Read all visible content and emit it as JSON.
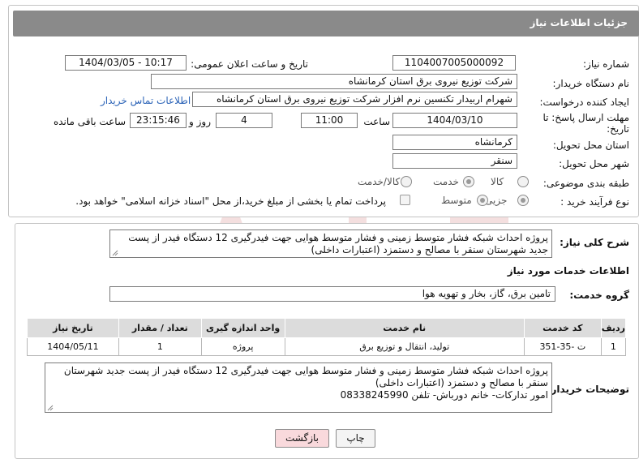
{
  "header": {
    "title": "جزئیات اطلاعات نیاز"
  },
  "form": {
    "need_number_label": "شماره نیاز:",
    "need_number": "1104007005000092",
    "announce_label": "تاریخ و ساعت اعلان عمومی:",
    "announce_value": "1404/03/05 - 10:17",
    "buyer_label": "نام دستگاه خریدار:",
    "buyer_value": "شرکت توزیع نیروی برق استان کرمانشاه",
    "creator_label": "ایجاد کننده درخواست:",
    "creator_value": "شهرام اربیدار تکنسین نرم افزار شرکت توزیع نیروی برق استان کرمانشاه",
    "contact_link": "اطلاعات تماس خریدار",
    "deadline_label_1": "مهلت ارسال پاسخ: تا",
    "deadline_label_2": "تاریخ:",
    "deadline_date": "1404/03/10",
    "time_label": "ساعت",
    "deadline_time": "11:00",
    "days_value": "4",
    "days_label": "روز و",
    "remaining_time": "23:15:46",
    "remaining_label": "ساعت باقی مانده",
    "province_label": "استان محل تحویل:",
    "province_value": "کرمانشاه",
    "city_label": "شهر محل تحویل:",
    "city_value": "سنقر",
    "category_label": "طبقه بندی موضوعی:",
    "category_options": [
      "کالا",
      "خدمت",
      "کالا/خدمت"
    ],
    "category_selected": "خدمت",
    "process_label": "نوع فرآیند خرید :",
    "process_options": [
      "جزیی",
      "متوسط"
    ],
    "process_selected": "متوسط",
    "payment_note": "پرداخت تمام یا بخشی از مبلغ خرید،از محل \"اسناد خزانه اسلامی\" خواهد بود."
  },
  "summary": {
    "label": "شرح کلی نیاز:",
    "text": "پروژه احداث شبکه فشار متوسط زمینی و فشار متوسط هوایی جهت فیدرگیری 12 دستگاه فیدر از پست جدید شهرستان سنقر با مصالح و دستمزد (اعتبارات داخلی)"
  },
  "services": {
    "section_title": "اطلاعات خدمات مورد نیاز",
    "group_label": "گروه خدمت:",
    "group_value": "تامین برق، گاز، بخار و تهویه هوا",
    "columns": [
      "ردیف",
      "کد خدمت",
      "نام خدمت",
      "واحد اندازه گیری",
      "تعداد / مقدار",
      "تاریخ نیاز"
    ],
    "rows": [
      [
        "1",
        "ت -35-351",
        "تولید، انتقال و توزیع برق",
        "پروژه",
        "1",
        "1404/05/11"
      ]
    ]
  },
  "buyer_notes": {
    "label": "توضیحات خریدار:",
    "line1": "پروژه احداث شبکه فشار متوسط زمینی و فشار متوسط هوایی جهت فیدرگیری 12 دستگاه فیدر از پست جدید شهرستان",
    "line2": "سنقر با مصالح و دستمزد (اعتبارات داخلی)",
    "line3": "امور تدارکات- خانم دورباش- تلفن 08338245990"
  },
  "buttons": {
    "print": "چاپ",
    "back": "بازگشت"
  },
  "colors": {
    "header": "#8a8a8a",
    "link": "#2b63b7",
    "back_button": "#f9d9dc",
    "watermark": "#e9b7b7"
  }
}
